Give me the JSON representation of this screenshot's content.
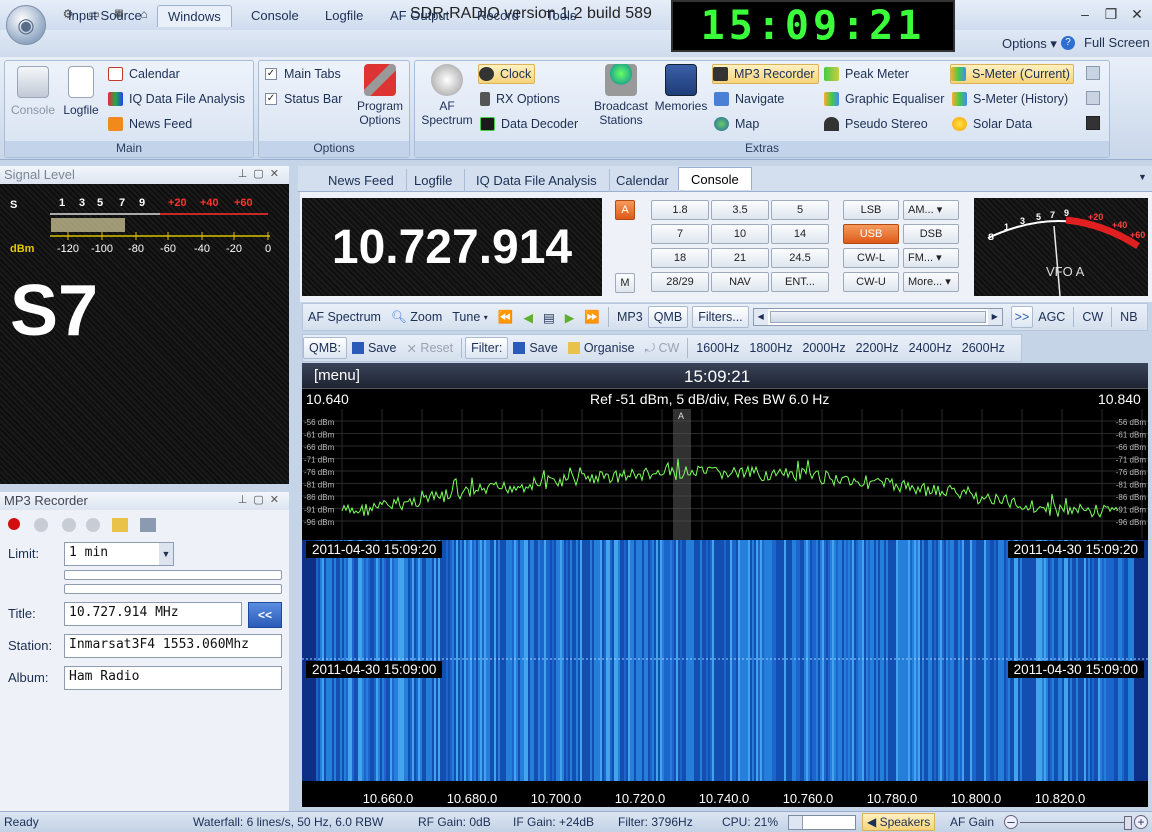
{
  "window": {
    "title": "SDR-RADIO version 1.2  build 589",
    "clock": "15:09:21"
  },
  "menu": {
    "tabs": [
      "Input Source",
      "Windows",
      "Console",
      "Logfile",
      "AF Output",
      "Record",
      "Tools"
    ],
    "active": "Windows",
    "options": "Options",
    "full_screen": "Full Screen"
  },
  "ribbon": {
    "main": {
      "label": "Main",
      "console": "Console",
      "logfile": "Logfile",
      "calendar": "Calendar",
      "iq": "IQ Data File Analysis",
      "news": "News Feed"
    },
    "options": {
      "label": "Options",
      "main_tabs": "Main Tabs",
      "status_bar": "Status Bar",
      "program_options_1": "Program",
      "program_options_2": "Options"
    },
    "extras": {
      "label": "Extras",
      "af_spectrum_1": "AF",
      "af_spectrum_2": "Spectrum",
      "clock": "Clock",
      "rx_options": "RX Options",
      "data_decoder": "Data Decoder",
      "broadcast_1": "Broadcast",
      "broadcast_2": "Stations",
      "memories": "Memories",
      "mp3_recorder": "MP3 Recorder",
      "navigate": "Navigate",
      "map": "Map",
      "peak_meter": "Peak Meter",
      "graphic_eq": "Graphic Equaliser",
      "pseudo_stereo": "Pseudo Stereo",
      "smeter_current": "S-Meter (Current)",
      "smeter_history": "S-Meter (History)",
      "solar_data": "Solar Data"
    }
  },
  "signal_panel": {
    "title": "Signal Level",
    "s_label": "S",
    "s_ticks": [
      "1",
      "3",
      "5",
      "7",
      "9"
    ],
    "plus_ticks": [
      "+20",
      "+40",
      "+60"
    ],
    "dbm_label": "dBm",
    "dbm_ticks": [
      "-120",
      "-100",
      "-80",
      "-60",
      "-40",
      "-20",
      "0"
    ],
    "reading": "S7"
  },
  "mp3_panel": {
    "title": "MP3 Recorder",
    "limit_label": "Limit:",
    "limit_value": "1 min",
    "title_label": "Title:",
    "title_value": "10.727.914 MHz",
    "copy_button": "<<",
    "station_label": "Station:",
    "station_value": "Inmarsat3F4 1553.060Mhz",
    "album_label": "Album:",
    "album_value": "Ham Radio"
  },
  "doc_tabs": [
    "News Feed",
    "Logfile",
    "IQ Data File Analysis",
    "Calendar",
    "Console"
  ],
  "doc_tab_active": "Console",
  "console": {
    "frequency": "10.727.914",
    "a_button": "A",
    "m_button": "M",
    "bands": [
      "1.8",
      "3.5",
      "5",
      "7",
      "10",
      "14",
      "18",
      "21",
      "24.5",
      "28/29",
      "NAV",
      "ENT..."
    ],
    "modes": [
      "LSB",
      "AM...",
      "USB",
      "DSB",
      "CW-L",
      "FM...",
      "CW-U",
      "More..."
    ],
    "active_mode": "USB",
    "vfo_label": "VFO A",
    "meter_scale": [
      "S",
      "1",
      "3",
      "5",
      "7",
      "9",
      "+20",
      "+40",
      "+60"
    ]
  },
  "toolbar1": {
    "af_spectrum": "AF Spectrum",
    "zoom": "Zoom",
    "tune": "Tune",
    "mp3": "MP3",
    "qmb": "QMB",
    "filters": "Filters...",
    "more": ">>",
    "agc": "AGC",
    "cw": "CW",
    "nb": "NB"
  },
  "toolbar2": {
    "qmb_label": "QMB:",
    "save": "Save",
    "reset": "Reset",
    "filter_label": "Filter:",
    "filter_save": "Save",
    "organise": "Organise",
    "cw": "CW",
    "widths": [
      "1600Hz",
      "1800Hz",
      "2000Hz",
      "2200Hz",
      "2400Hz",
      "2600Hz"
    ]
  },
  "spectrum": {
    "menu": "[menu]",
    "time": "15:09:21",
    "freq_start": "10.640",
    "freq_end": "10.840",
    "ref_info": "Ref -51 dBm,  5 dB/div,  Res BW 6.0 Hz",
    "db_labels": [
      "-56 dBm",
      "-61 dBm",
      "-66 dBm",
      "-71 dBm",
      "-76 dBm",
      "-81 dBm",
      "-86 dBm",
      "-91 dBm",
      "-96 dBm"
    ],
    "marker": "A",
    "timestamp1": "2011-04-30   15:09:20",
    "timestamp2": "2011-04-30   15:09:00",
    "freq_axis": [
      "10.660.0",
      "10.680.0",
      "10.700.0",
      "10.720.0",
      "10.740.0",
      "10.760.0",
      "10.780.0",
      "10.800.0",
      "10.820.0"
    ],
    "trace_color": "#7cff5a",
    "waterfall_color": "#1e6fd8"
  },
  "status": {
    "ready": "Ready",
    "waterfall": "Waterfall: 6 lines/s, 50 Hz, 6.0 RBW",
    "rf_gain": "RF Gain: 0dB",
    "if_gain": "IF Gain: +24dB",
    "filter": "Filter: 3796Hz",
    "cpu": "CPU: 21%",
    "speakers": "Speakers",
    "af_gain": "AF Gain"
  }
}
